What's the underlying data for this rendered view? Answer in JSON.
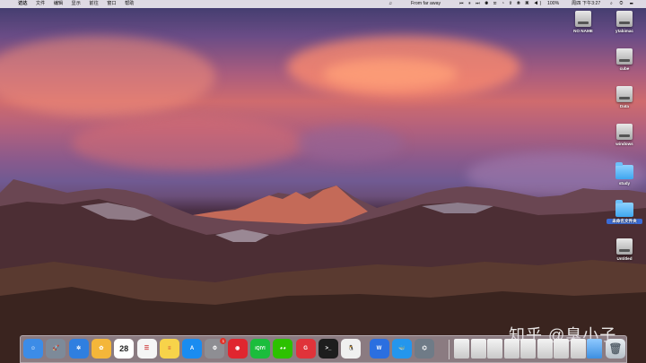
{
  "menubar": {
    "apple": "",
    "items": [
      "访达",
      "文件",
      "编辑",
      "显示",
      "前往",
      "窗口",
      "帮助"
    ],
    "music_icon": "♫",
    "now_playing": "From far away",
    "media_controls": "⏮ ⏸ ⏭ ◉ ✉ ◔ ⇧ ⦿ ▣ ◀)",
    "battery": "100%",
    "clock": "周四 下午3:27",
    "right_icons": "⌕ ◎ ☰"
  },
  "desktop_icons": [
    {
      "name": "NO NAME",
      "type": "drive"
    },
    {
      "name": "ytabimac",
      "type": "drive"
    },
    {
      "name": "cube",
      "type": "drive"
    },
    {
      "name": "Data",
      "type": "drive"
    },
    {
      "name": "windows",
      "type": "drive"
    },
    {
      "name": "study",
      "type": "folder"
    },
    {
      "name": "未命名文件夹",
      "type": "folder"
    },
    {
      "name": "Untitled",
      "type": "drive"
    }
  ],
  "watermark": "知乎 @臭小子",
  "dock": {
    "apps": [
      {
        "name": "Finder",
        "icon": "finder-icon",
        "glyph": "☺",
        "color": "#3c8ce7"
      },
      {
        "name": "Launchpad",
        "icon": "launchpad-icon",
        "glyph": "🚀",
        "color": "#7d8a99"
      },
      {
        "name": "Safari",
        "icon": "safari-icon",
        "glyph": "✲",
        "color": "#2f7fe0"
      },
      {
        "name": "Photos",
        "icon": "photos-icon",
        "glyph": "✿",
        "color": "#f4b63a"
      },
      {
        "name": "Calendar",
        "icon": "calendar-icon",
        "glyph": "28",
        "color": "#ffffff"
      },
      {
        "name": "Reminders",
        "icon": "reminders-icon",
        "glyph": "☰",
        "color": "#f5f5f5"
      },
      {
        "name": "Notes",
        "icon": "notes-icon",
        "glyph": "≡",
        "color": "#f7d34a"
      },
      {
        "name": "App Store",
        "icon": "app-store-icon",
        "glyph": "A",
        "color": "#1a8cf0"
      },
      {
        "name": "System Preferences",
        "icon": "system-preferences-icon",
        "glyph": "⚙",
        "color": "#8e8e93"
      },
      {
        "name": "NetEase Music",
        "icon": "netease-music-icon",
        "glyph": "◉",
        "color": "#e0262f"
      },
      {
        "name": "iQIYI",
        "icon": "iqiyi-icon",
        "glyph": "iQIYI",
        "color": "#1bbd3c"
      },
      {
        "name": "WeChat",
        "icon": "wechat-icon",
        "glyph": "◕◕",
        "color": "#2dc100"
      },
      {
        "name": "G App",
        "icon": "g-app-icon",
        "glyph": "G",
        "color": "#e0333a"
      },
      {
        "name": "Terminal",
        "icon": "terminal-icon",
        "glyph": ">_",
        "color": "#1d1d1d"
      },
      {
        "name": "QQ",
        "icon": "qq-icon",
        "glyph": "🐧",
        "color": "#f0f0f0"
      },
      {
        "name": "WPS",
        "icon": "wps-icon",
        "glyph": "W",
        "color": "#2b6fe0"
      },
      {
        "name": "Docker",
        "icon": "docker-icon",
        "glyph": "🐳",
        "color": "#2496ed"
      },
      {
        "name": "Network Utility",
        "icon": "network-icon",
        "glyph": "⌬",
        "color": "#6f7b87"
      }
    ],
    "minimized": [
      {
        "name": "Preview",
        "icon": "preview-doc-icon"
      },
      {
        "name": "Window 1",
        "icon": "window-thumb-icon"
      },
      {
        "name": "Window 2",
        "icon": "window-thumb-icon"
      },
      {
        "name": "Window 3",
        "icon": "window-thumb-icon"
      },
      {
        "name": "Window 4",
        "icon": "window-thumb-icon"
      },
      {
        "name": "Window 5",
        "icon": "window-thumb-icon"
      },
      {
        "name": "Window 6",
        "icon": "window-thumb-icon"
      },
      {
        "name": "Window 7",
        "icon": "window-thumb-icon"
      },
      {
        "name": "Downloads",
        "icon": "downloads-icon"
      }
    ],
    "trash": {
      "name": "Trash",
      "icon": "trash-icon"
    },
    "badge_count": "1"
  }
}
